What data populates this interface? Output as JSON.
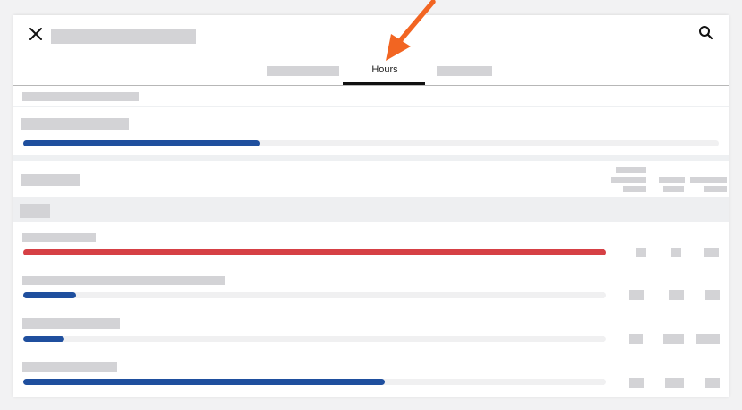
{
  "tabs": {
    "active_label": "Hours"
  },
  "colors": {
    "accent_blue": "#1f4f9e",
    "over_budget_red": "#d64045",
    "annotation_orange": "#f26522"
  },
  "icons": {
    "close": "close-icon",
    "search": "search-icon",
    "annotation": "arrow-icon"
  },
  "summary": {
    "progress": 0.34
  },
  "rows": [
    {
      "progress": 1.0,
      "color": "#d64045"
    },
    {
      "progress": 0.09,
      "color": "#1f4f9e"
    },
    {
      "progress": 0.07,
      "color": "#1f4f9e"
    },
    {
      "progress": 0.62,
      "color": "#1f4f9e"
    }
  ]
}
